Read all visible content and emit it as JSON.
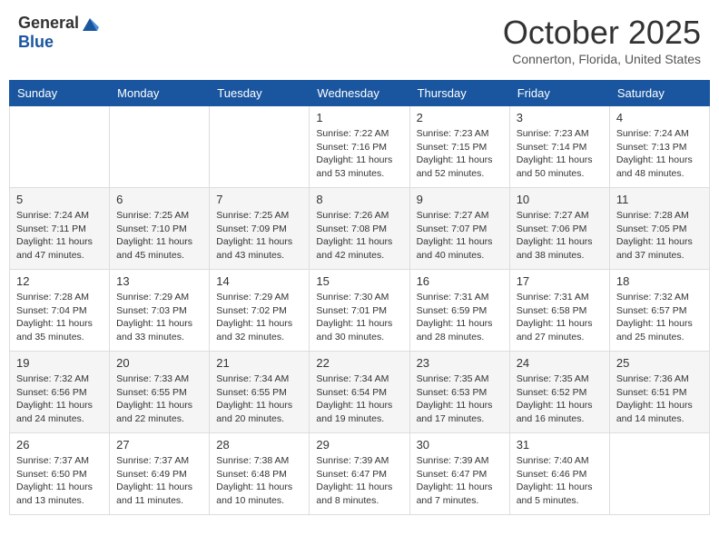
{
  "header": {
    "logo_general": "General",
    "logo_blue": "Blue",
    "month_title": "October 2025",
    "location": "Connerton, Florida, United States"
  },
  "days_of_week": [
    "Sunday",
    "Monday",
    "Tuesday",
    "Wednesday",
    "Thursday",
    "Friday",
    "Saturday"
  ],
  "weeks": [
    [
      {
        "day": "",
        "info": ""
      },
      {
        "day": "",
        "info": ""
      },
      {
        "day": "",
        "info": ""
      },
      {
        "day": "1",
        "info": "Sunrise: 7:22 AM\nSunset: 7:16 PM\nDaylight: 11 hours\nand 53 minutes."
      },
      {
        "day": "2",
        "info": "Sunrise: 7:23 AM\nSunset: 7:15 PM\nDaylight: 11 hours\nand 52 minutes."
      },
      {
        "day": "3",
        "info": "Sunrise: 7:23 AM\nSunset: 7:14 PM\nDaylight: 11 hours\nand 50 minutes."
      },
      {
        "day": "4",
        "info": "Sunrise: 7:24 AM\nSunset: 7:13 PM\nDaylight: 11 hours\nand 48 minutes."
      }
    ],
    [
      {
        "day": "5",
        "info": "Sunrise: 7:24 AM\nSunset: 7:11 PM\nDaylight: 11 hours\nand 47 minutes."
      },
      {
        "day": "6",
        "info": "Sunrise: 7:25 AM\nSunset: 7:10 PM\nDaylight: 11 hours\nand 45 minutes."
      },
      {
        "day": "7",
        "info": "Sunrise: 7:25 AM\nSunset: 7:09 PM\nDaylight: 11 hours\nand 43 minutes."
      },
      {
        "day": "8",
        "info": "Sunrise: 7:26 AM\nSunset: 7:08 PM\nDaylight: 11 hours\nand 42 minutes."
      },
      {
        "day": "9",
        "info": "Sunrise: 7:27 AM\nSunset: 7:07 PM\nDaylight: 11 hours\nand 40 minutes."
      },
      {
        "day": "10",
        "info": "Sunrise: 7:27 AM\nSunset: 7:06 PM\nDaylight: 11 hours\nand 38 minutes."
      },
      {
        "day": "11",
        "info": "Sunrise: 7:28 AM\nSunset: 7:05 PM\nDaylight: 11 hours\nand 37 minutes."
      }
    ],
    [
      {
        "day": "12",
        "info": "Sunrise: 7:28 AM\nSunset: 7:04 PM\nDaylight: 11 hours\nand 35 minutes."
      },
      {
        "day": "13",
        "info": "Sunrise: 7:29 AM\nSunset: 7:03 PM\nDaylight: 11 hours\nand 33 minutes."
      },
      {
        "day": "14",
        "info": "Sunrise: 7:29 AM\nSunset: 7:02 PM\nDaylight: 11 hours\nand 32 minutes."
      },
      {
        "day": "15",
        "info": "Sunrise: 7:30 AM\nSunset: 7:01 PM\nDaylight: 11 hours\nand 30 minutes."
      },
      {
        "day": "16",
        "info": "Sunrise: 7:31 AM\nSunset: 6:59 PM\nDaylight: 11 hours\nand 28 minutes."
      },
      {
        "day": "17",
        "info": "Sunrise: 7:31 AM\nSunset: 6:58 PM\nDaylight: 11 hours\nand 27 minutes."
      },
      {
        "day": "18",
        "info": "Sunrise: 7:32 AM\nSunset: 6:57 PM\nDaylight: 11 hours\nand 25 minutes."
      }
    ],
    [
      {
        "day": "19",
        "info": "Sunrise: 7:32 AM\nSunset: 6:56 PM\nDaylight: 11 hours\nand 24 minutes."
      },
      {
        "day": "20",
        "info": "Sunrise: 7:33 AM\nSunset: 6:55 PM\nDaylight: 11 hours\nand 22 minutes."
      },
      {
        "day": "21",
        "info": "Sunrise: 7:34 AM\nSunset: 6:55 PM\nDaylight: 11 hours\nand 20 minutes."
      },
      {
        "day": "22",
        "info": "Sunrise: 7:34 AM\nSunset: 6:54 PM\nDaylight: 11 hours\nand 19 minutes."
      },
      {
        "day": "23",
        "info": "Sunrise: 7:35 AM\nSunset: 6:53 PM\nDaylight: 11 hours\nand 17 minutes."
      },
      {
        "day": "24",
        "info": "Sunrise: 7:35 AM\nSunset: 6:52 PM\nDaylight: 11 hours\nand 16 minutes."
      },
      {
        "day": "25",
        "info": "Sunrise: 7:36 AM\nSunset: 6:51 PM\nDaylight: 11 hours\nand 14 minutes."
      }
    ],
    [
      {
        "day": "26",
        "info": "Sunrise: 7:37 AM\nSunset: 6:50 PM\nDaylight: 11 hours\nand 13 minutes."
      },
      {
        "day": "27",
        "info": "Sunrise: 7:37 AM\nSunset: 6:49 PM\nDaylight: 11 hours\nand 11 minutes."
      },
      {
        "day": "28",
        "info": "Sunrise: 7:38 AM\nSunset: 6:48 PM\nDaylight: 11 hours\nand 10 minutes."
      },
      {
        "day": "29",
        "info": "Sunrise: 7:39 AM\nSunset: 6:47 PM\nDaylight: 11 hours\nand 8 minutes."
      },
      {
        "day": "30",
        "info": "Sunrise: 7:39 AM\nSunset: 6:47 PM\nDaylight: 11 hours\nand 7 minutes."
      },
      {
        "day": "31",
        "info": "Sunrise: 7:40 AM\nSunset: 6:46 PM\nDaylight: 11 hours\nand 5 minutes."
      },
      {
        "day": "",
        "info": ""
      }
    ]
  ]
}
